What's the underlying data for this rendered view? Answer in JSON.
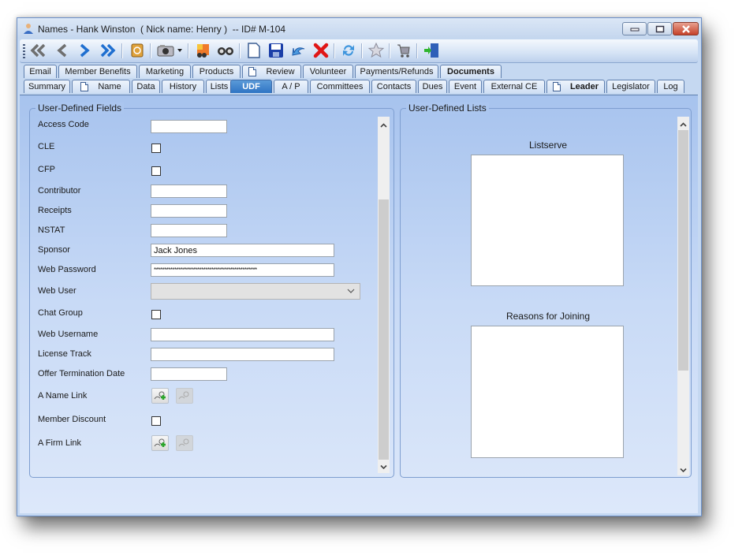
{
  "window": {
    "title": "Names - Hank Winston  ( Nick name: Henry )  -- ID# M-104"
  },
  "toolbar": {
    "buttons": [
      {
        "name": "first-record",
        "icon": "double-chevron-left-icon"
      },
      {
        "name": "previous-record",
        "icon": "chevron-left-icon"
      },
      {
        "name": "next-record",
        "icon": "chevron-right-icon"
      },
      {
        "name": "last-record",
        "icon": "double-chevron-right-icon"
      },
      {
        "name": "address-book",
        "icon": "address-book-icon"
      },
      {
        "name": "camera",
        "icon": "camera-icon"
      },
      {
        "name": "camera-dropdown",
        "icon": "dropdown-arrow-icon"
      },
      {
        "name": "find-image",
        "icon": "image-search-icon"
      },
      {
        "name": "search",
        "icon": "binoculars-icon"
      },
      {
        "name": "new",
        "icon": "new-document-icon"
      },
      {
        "name": "save",
        "icon": "save-icon"
      },
      {
        "name": "undo",
        "icon": "undo-icon"
      },
      {
        "name": "delete",
        "icon": "delete-icon"
      },
      {
        "name": "refresh",
        "icon": "refresh-icon"
      },
      {
        "name": "favorite",
        "icon": "star-icon"
      },
      {
        "name": "cart",
        "icon": "cart-icon"
      },
      {
        "name": "exit",
        "icon": "exit-door-icon"
      }
    ]
  },
  "tabs": {
    "row1": [
      "Email",
      "Member Benefits",
      "Marketing",
      "Products",
      "Review",
      "Volunteer",
      "Payments/Refunds",
      "Documents"
    ],
    "row2": [
      "Summary",
      "Name",
      "Data",
      "History",
      "Lists",
      "UDF",
      "A / P",
      "Committees",
      "Contacts",
      "Dues",
      "Event",
      "External CE",
      "Leader",
      "Legislator",
      "Log"
    ],
    "active": "UDF"
  },
  "udf": {
    "title": "User-Defined Fields",
    "fields": [
      {
        "label": "Access Code",
        "type": "text",
        "value": ""
      },
      {
        "label": "CLE",
        "type": "checkbox",
        "checked": false
      },
      {
        "label": "CFP",
        "type": "checkbox",
        "checked": false
      },
      {
        "label": "Contributor",
        "type": "text",
        "value": ""
      },
      {
        "label": "Receipts",
        "type": "text",
        "value": ""
      },
      {
        "label": "NSTAT",
        "type": "text",
        "value": ""
      },
      {
        "label": "Sponsor",
        "type": "text",
        "value": "Jack Jones"
      },
      {
        "label": "Web Password",
        "type": "password",
        "value": "**************************************************"
      },
      {
        "label": "Web User",
        "type": "select",
        "value": ""
      },
      {
        "label": "Chat Group",
        "type": "checkbox",
        "checked": false
      },
      {
        "label": "Web Username",
        "type": "text",
        "value": ""
      },
      {
        "label": "License Track",
        "type": "text",
        "value": ""
      },
      {
        "label": "Offer Termination Date",
        "type": "text",
        "value": ""
      },
      {
        "label": "A Name Link",
        "type": "link"
      },
      {
        "label": "Member Discount",
        "type": "checkbox",
        "checked": false
      },
      {
        "label": "A Firm Link",
        "type": "link"
      }
    ]
  },
  "udl": {
    "title": "User-Defined Lists",
    "lists": [
      {
        "label": "Listserve",
        "items": []
      },
      {
        "label": "Reasons for Joining",
        "items": []
      }
    ]
  },
  "colors": {
    "accent": "#2f74c4",
    "panel": "#c5d8f1",
    "close": "#c5412a"
  }
}
